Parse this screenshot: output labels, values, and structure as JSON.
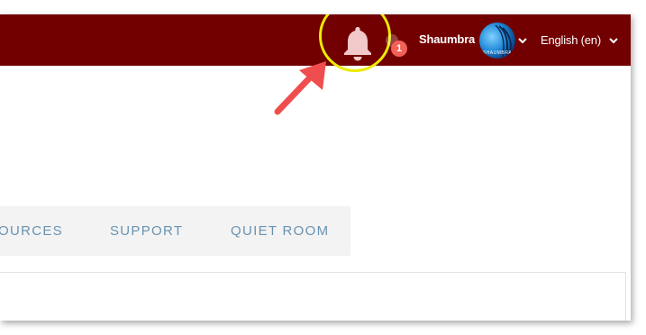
{
  "header": {
    "bar_color": "#730000",
    "notification_icon": "bell-icon",
    "notification_count": "1",
    "user_name": "Shaumbra",
    "avatar_text": "SHAUMBRA",
    "language": "English (en)"
  },
  "nav": {
    "items": [
      "OURCES",
      "SUPPORT",
      "QUIET ROOM"
    ]
  },
  "annotations": {
    "highlight_color": "#ecec00",
    "arrow_color": "#f04e4e"
  }
}
